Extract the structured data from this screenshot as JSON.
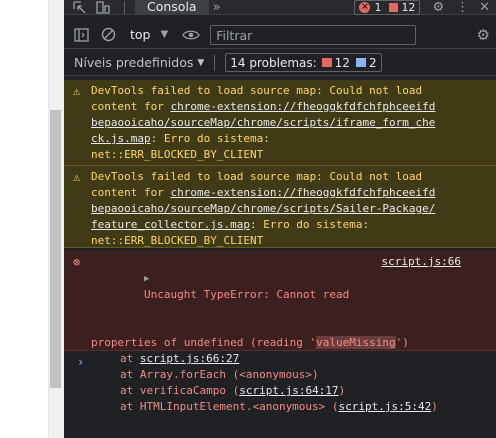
{
  "tabs": {
    "active": "Consola"
  },
  "counts": {
    "errors": "1",
    "warnings": "12"
  },
  "toolbar": {
    "context": "top",
    "filter_placeholder": "Filtrar"
  },
  "levels": {
    "label": "Níveis predefinidos",
    "issues_label": "14 problemas:",
    "issues_errors": "12",
    "issues_info": "2"
  },
  "messages": {
    "warn1": {
      "l1": "DevTools failed to load source map: Could not load",
      "l2_pre": "content for ",
      "l2_link": "chrome-extension://fheoggkfdfchfphceeifd",
      "l3_link": "bepaooicaho/sourceMap/chrome/scripts/iframe_form_che",
      "l4_link": "ck.js.map",
      "l4_post": ": Erro do sistema:",
      "l5": "net::ERR_BLOCKED_BY_CLIENT"
    },
    "warn2": {
      "l1": "DevTools failed to load source map: Could not load",
      "l2_pre": "content for ",
      "l2_link": "chrome-extension://fheoggkfdfchfphceeifd",
      "l3_link": "bepaooicaho/sourceMap/chrome/scripts/Sailer-Package/",
      "l4_link": "feature_collector.js.map",
      "l4_post": ": Erro do sistema:",
      "l5": "net::ERR_BLOCKED_BY_CLIENT"
    },
    "error": {
      "l1": "Uncaught TypeError: Cannot read",
      "source": "script.js:66",
      "l2_pre": "properties of undefined (reading '",
      "l2_hl": "valueMissing",
      "l2_post": "')",
      "stack": [
        {
          "pre": "at ",
          "link": "script.js:66:27",
          "post": ""
        },
        {
          "pre": "at Array.forEach (<anonymous>)",
          "link": "",
          "post": ""
        },
        {
          "pre": "at verificaCampo (",
          "link": "script.js:64:17",
          "post": ")"
        },
        {
          "pre": "at HTMLInputElement.<anonymous> (",
          "link": "script.js:5:42",
          "post": ")"
        }
      ]
    }
  }
}
